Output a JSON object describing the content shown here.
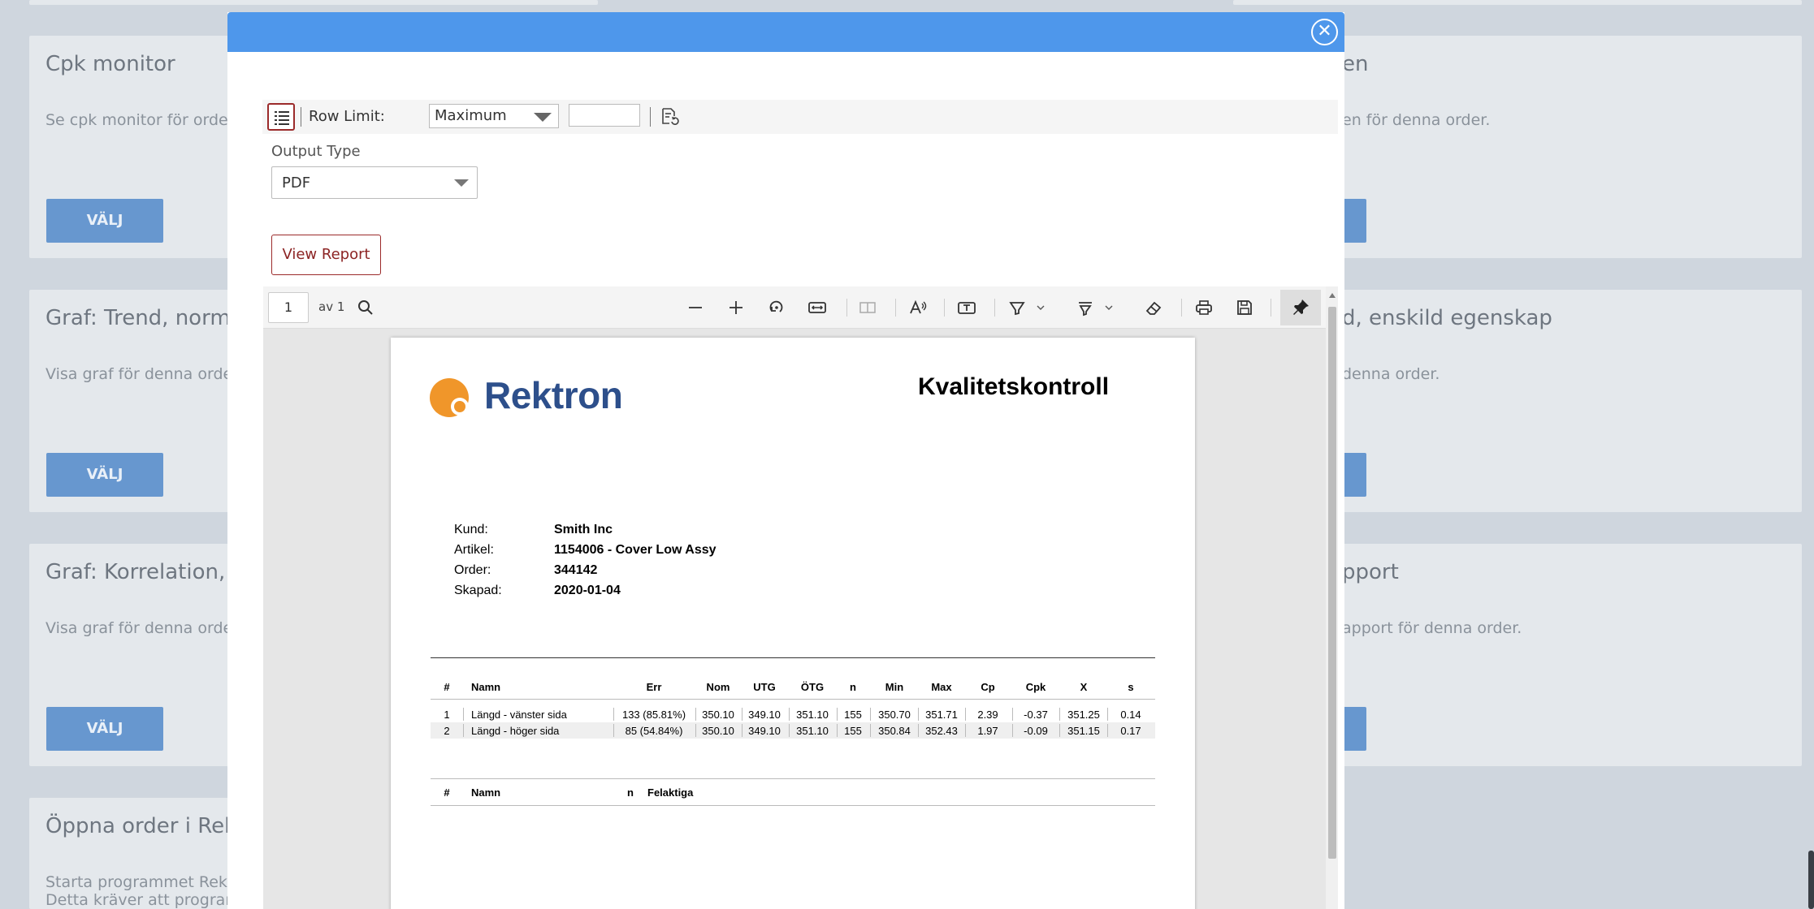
{
  "background": {
    "cards_left": [
      {
        "title": "Cpk monitor",
        "desc": "Se cpk monitor för order",
        "button": "VÄLJ"
      },
      {
        "title": "Graf: Trend, norme",
        "desc": "Visa graf för denna order.",
        "button": "VÄLJ"
      },
      {
        "title": "Graf: Korrelation, fl",
        "desc": "Visa graf för denna order.",
        "button": "VÄLJ"
      },
      {
        "title": "Öppna order i Rekt",
        "desc_line1": "Starta programmet Rektro",
        "desc_line2": "Detta kräver att programv"
      }
    ],
    "cards_right": [
      {
        "title": "en",
        "desc": "en för denna order."
      },
      {
        "title": "d, enskild egenskap",
        "desc": "denna order."
      },
      {
        "title": "pport",
        "desc": "apport för denna order."
      }
    ]
  },
  "modal": {
    "close_symbol": "✕",
    "toolbar": {
      "row_limit_label": "Row Limit:",
      "row_limit_value": "Maximum",
      "row_limit_input": ""
    },
    "output_type_label": "Output Type",
    "output_type_value": "PDF",
    "view_report_label": "View Report",
    "viewer": {
      "page_number": "1",
      "page_of": "av 1",
      "icons": [
        "search-icon",
        "zoom-out-icon",
        "zoom-in-icon",
        "rotate-icon",
        "fit-width-icon",
        "page-view-icon",
        "read-aloud-icon",
        "text-box-icon",
        "highlight-icon",
        "draw-icon",
        "erase-icon",
        "print-icon",
        "save-icon",
        "pin-icon"
      ]
    },
    "report": {
      "brand": "Rektron",
      "title": "Kvalitetskontroll",
      "info": [
        {
          "key": "Kund:",
          "value": "Smith Inc"
        },
        {
          "key": "Artikel:",
          "value": "1154006 - Cover Low Assy"
        },
        {
          "key": "Order:",
          "value": "344142"
        },
        {
          "key": "Skapad:",
          "value": "2020-01-04"
        }
      ],
      "table1": {
        "headers": [
          "#",
          "Namn",
          "Err",
          "Nom",
          "UTG",
          "ÖTG",
          "n",
          "Min",
          "Max",
          "Cp",
          "Cpk",
          "X",
          "s"
        ],
        "rows": [
          [
            "1",
            "Längd - vänster sida",
            "133 (85.81%)",
            "350.10",
            "349.10",
            "351.10",
            "155",
            "350.70",
            "351.71",
            "2.39",
            "-0.37",
            "351.25",
            "0.14"
          ],
          [
            "2",
            "Längd - höger sida",
            "85 (54.84%)",
            "350.10",
            "349.10",
            "351.10",
            "155",
            "350.84",
            "352.43",
            "1.97",
            "-0.09",
            "351.15",
            "0.17"
          ]
        ]
      },
      "table2": {
        "headers": [
          "#",
          "Namn",
          "n",
          "Felaktiga"
        ]
      }
    }
  },
  "colors": {
    "modal_header": "#4e97eb",
    "accent_red": "#9b2a2a",
    "brand_blue": "#2d4f8b",
    "brand_orange": "#f0962a",
    "bg_button": "#6797cf"
  }
}
